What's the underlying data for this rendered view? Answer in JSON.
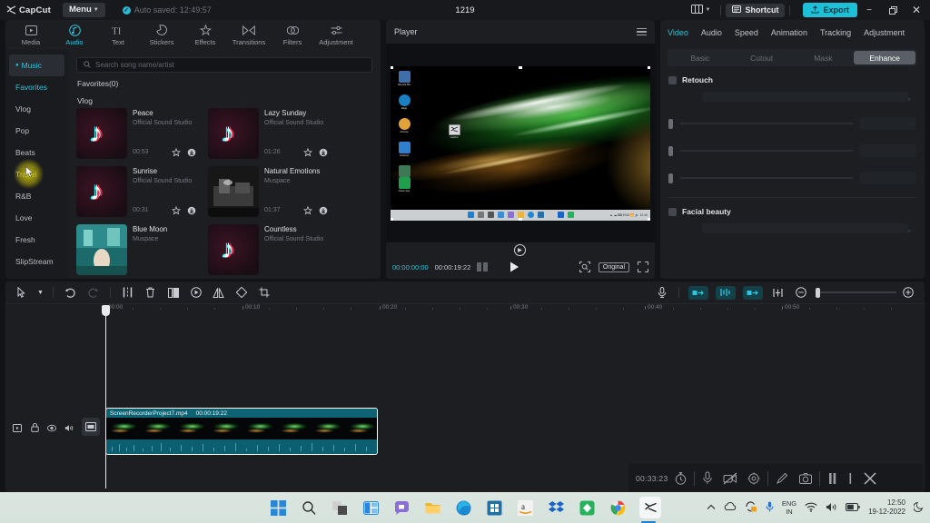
{
  "titlebar": {
    "app_name": "CapCut",
    "menu_label": "Menu",
    "autosave_text": "Auto saved: 12:49:57",
    "project_title": "1219",
    "shortcut_label": "Shortcut",
    "export_label": "Export",
    "layout_icon": "layout-icon",
    "minimize_icon": "minimize-icon",
    "maximize_icon": "maximize-icon",
    "close_icon": "close-icon"
  },
  "tool_tabs": [
    {
      "label": "Media",
      "icon": "media-icon",
      "active": false
    },
    {
      "label": "Audio",
      "icon": "audio-note-icon",
      "active": true
    },
    {
      "label": "Text",
      "icon": "text-icon",
      "active": false
    },
    {
      "label": "Stickers",
      "icon": "sticker-icon",
      "active": false
    },
    {
      "label": "Effects",
      "icon": "effects-icon",
      "active": false
    },
    {
      "label": "Transitions",
      "icon": "transitions-icon",
      "active": false
    },
    {
      "label": "Filters",
      "icon": "filters-icon",
      "active": false
    },
    {
      "label": "Adjustment",
      "icon": "adjustment-icon",
      "active": false
    }
  ],
  "library": {
    "categories": [
      {
        "label": "Music",
        "state": "selected"
      },
      {
        "label": "Favorites",
        "state": "highlight"
      },
      {
        "label": "Vlog",
        "state": "normal"
      },
      {
        "label": "Pop",
        "state": "normal"
      },
      {
        "label": "Beats",
        "state": "normal"
      },
      {
        "label": "Travel",
        "state": "hover"
      },
      {
        "label": "R&B",
        "state": "normal"
      },
      {
        "label": "Love",
        "state": "normal"
      },
      {
        "label": "Fresh",
        "state": "normal"
      },
      {
        "label": "SlipStream",
        "state": "normal"
      }
    ],
    "search_placeholder": "Search song name/artist",
    "favorites_header": "Favorites(0)",
    "vlog_header": "Vlog",
    "songs": [
      {
        "title": "Peace",
        "artist": "Official Sound Studio",
        "duration": "00:53",
        "thumb": "tiktok"
      },
      {
        "title": "Lazy Sunday",
        "artist": "Official Sound Studio",
        "duration": "01:26",
        "thumb": "tiktok"
      },
      {
        "title": "Sunrise",
        "artist": "Official Sound Studio",
        "duration": "00:31",
        "thumb": "tiktok"
      },
      {
        "title": "Natural Emotions",
        "artist": "Muspace",
        "duration": "01:37",
        "thumb": "photo"
      },
      {
        "title": "Blue Moon",
        "artist": "Muspace",
        "duration": "",
        "thumb": "photo2"
      },
      {
        "title": "Countless",
        "artist": "Official Sound Studio",
        "duration": "",
        "thumb": "tiktok"
      }
    ],
    "favorite_icon": "star-icon",
    "download_icon": "download-icon"
  },
  "player": {
    "title": "Player",
    "menu_icon": "hamburger-icon",
    "current_time": "00:00:00:00",
    "total_time": "00:00:19:22",
    "frames_icon": "frames-icon",
    "play_icon": "play-icon",
    "crop_icon": "crop-focus-icon",
    "ratio_label": "Original",
    "fullscreen_icon": "fullscreen-icon",
    "center_icon": "marker-icon"
  },
  "inspector": {
    "tabs": [
      {
        "label": "Video",
        "active": true
      },
      {
        "label": "Audio",
        "active": false
      },
      {
        "label": "Speed",
        "active": false
      },
      {
        "label": "Animation",
        "active": false
      },
      {
        "label": "Tracking",
        "active": false
      },
      {
        "label": "Adjustment",
        "active": false
      }
    ],
    "subtabs": [
      {
        "label": "Basic",
        "active": false
      },
      {
        "label": "Cutout",
        "active": false
      },
      {
        "label": "Mask",
        "active": false
      },
      {
        "label": "Enhance",
        "active": true
      }
    ],
    "sections": [
      {
        "label": "Retouch",
        "checked": false
      },
      {
        "label": "Facial beauty",
        "checked": false
      }
    ]
  },
  "timeline": {
    "toolbar_left": [
      {
        "icon": "select-arrow-icon",
        "enabled": true
      },
      {
        "icon": "chevron-down-icon",
        "enabled": true
      },
      {
        "icon": "undo-icon",
        "enabled": true
      },
      {
        "icon": "redo-icon",
        "enabled": false
      },
      {
        "icon": "split-icon",
        "enabled": true
      },
      {
        "icon": "delete-icon",
        "enabled": true
      },
      {
        "icon": "freeze-icon",
        "enabled": true
      },
      {
        "icon": "reverse-icon",
        "enabled": true
      },
      {
        "icon": "mirror-icon",
        "enabled": true
      },
      {
        "icon": "rotate-icon",
        "enabled": true
      },
      {
        "icon": "crop-icon",
        "enabled": true
      }
    ],
    "toolbar_right": [
      {
        "icon": "microphone-icon",
        "highlight": false
      },
      {
        "icon": "auto-caption-icon",
        "highlight": true
      },
      {
        "icon": "auto-sync-icon",
        "highlight": true
      },
      {
        "icon": "text-to-audio-icon",
        "highlight": true
      },
      {
        "icon": "split-link-icon",
        "highlight": false
      },
      {
        "icon": "zoom-out-icon",
        "highlight": false
      },
      {
        "icon": "zoom-in-icon",
        "highlight": false
      }
    ],
    "ruler_labels": [
      "00:00",
      "00:10",
      "00:20",
      "00:30",
      "00:40",
      "00:50"
    ],
    "track_controls": [
      {
        "icon": "video-track-icon"
      },
      {
        "icon": "lock-icon"
      },
      {
        "icon": "eye-icon"
      },
      {
        "icon": "speaker-icon"
      }
    ],
    "track_badge_icon": "main-track-icon",
    "clip": {
      "name": "ScreenRecorderProject7.mp4",
      "duration": "00:00:19:22"
    }
  },
  "recorder_overlay": {
    "time": "00:33:23",
    "icons": [
      {
        "name": "stopwatch-icon"
      },
      {
        "name": "microphone-icon"
      },
      {
        "name": "camera-off-icon"
      },
      {
        "name": "settings-gear-icon"
      },
      {
        "name": "pencil-icon"
      },
      {
        "name": "screenshot-icon"
      },
      {
        "name": "pause-icon"
      },
      {
        "name": "stop-icon"
      },
      {
        "name": "close-icon"
      }
    ]
  },
  "windows_taskbar": {
    "icons": [
      {
        "name": "start-icon"
      },
      {
        "name": "search-icon"
      },
      {
        "name": "task-view-icon"
      },
      {
        "name": "widgets-icon"
      },
      {
        "name": "chat-icon"
      },
      {
        "name": "file-explorer-icon"
      },
      {
        "name": "edge-icon"
      },
      {
        "name": "microsoft-store-icon"
      },
      {
        "name": "amazon-icon"
      },
      {
        "name": "dropbox-icon"
      },
      {
        "name": "green-app-icon"
      },
      {
        "name": "chrome-icon"
      },
      {
        "name": "capcut-taskbar-icon"
      }
    ],
    "tray": {
      "chevron_icon": "chevron-up-icon",
      "cloud_icon": "cloud-icon",
      "sync_icon": "sync-icon",
      "mic_icon": "microphone-icon",
      "language_line1": "ENG",
      "language_line2": "IN",
      "wifi_icon": "wifi-icon",
      "volume_icon": "volume-icon",
      "battery_icon": "battery-icon",
      "time": "12:50",
      "date": "19-12-2022",
      "moon_icon": "moon-icon"
    }
  },
  "colors": {
    "accent": "#2ec5dd",
    "panel": "#1c1e22",
    "clip": "#0c5a68"
  }
}
